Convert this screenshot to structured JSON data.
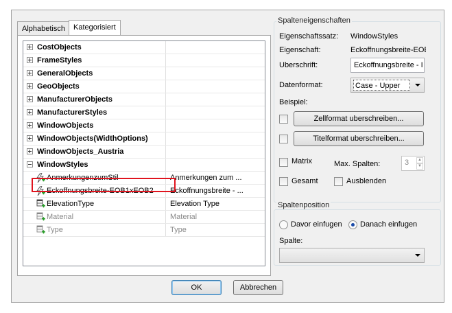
{
  "tabs": [
    {
      "label": "Alphabetisch",
      "active": false
    },
    {
      "label": "Kategorisiert",
      "active": true
    }
  ],
  "property_grid": {
    "groups": [
      {
        "label": "CostObjects",
        "expanded": false
      },
      {
        "label": "FrameStyles",
        "expanded": false
      },
      {
        "label": "GeneralObjects",
        "expanded": false
      },
      {
        "label": "GeoObjects",
        "expanded": false
      },
      {
        "label": "ManufacturerObjects",
        "expanded": false
      },
      {
        "label": "ManufacturerStyles",
        "expanded": false
      },
      {
        "label": "WindowObjects",
        "expanded": false
      },
      {
        "label": "WindowObjects(WidthOptions)",
        "expanded": false
      },
      {
        "label": "WindowObjects_Austria",
        "expanded": false
      },
      {
        "label": "WindowStyles",
        "expanded": true
      }
    ],
    "items": [
      {
        "name": "AnmerkungenzumStil",
        "value": "Anmerkungen zum ...",
        "icon": "lightning-add-icon",
        "muted": false
      },
      {
        "name": "Eckoffnungsbreite-EOB1xEOB2",
        "value": "Eckoffnungsbreite - ...",
        "icon": "lightning-add-icon",
        "muted": false,
        "selected_outline": true
      },
      {
        "name": "ElevationType",
        "value": "Elevation Type",
        "icon": "table-add-icon",
        "muted": false
      },
      {
        "name": "Material",
        "value": "Material",
        "icon": "table-add-icon",
        "muted": true
      },
      {
        "name": "Type",
        "value": "Type",
        "icon": "table-add-icon",
        "muted": true
      }
    ]
  },
  "column_props": {
    "title": "Spalteneigenschaften",
    "property_set_label": "Eigenschaftssatz:",
    "property_set_value": "WindowStyles",
    "property_label": "Eigenschaft:",
    "property_value": "Eckoffnungsbreite-EOB",
    "heading_label": "Uberschrift:",
    "heading_value": "Eckoffnungsbreite - I",
    "dataformat_label": "Datenformat:",
    "dataformat_value": "Case - Upper",
    "example_label": "Beispiel:",
    "cell_override_button": "Zellformat uberschreiben...",
    "title_override_button": "Titelformat uberschreiben...",
    "matrix_label": "Matrix",
    "max_columns_label": "Max. Spalten:",
    "max_columns_value": "3",
    "total_label": "Gesamt",
    "hide_label": "Ausblenden"
  },
  "column_position": {
    "title": "Spaltenposition",
    "before_label": "Davor einfugen",
    "after_label": "Danach einfugen",
    "selected": "after",
    "column_label": "Spalte:",
    "column_value": ""
  },
  "footer": {
    "ok_label": "OK",
    "cancel_label": "Abbrechen"
  }
}
